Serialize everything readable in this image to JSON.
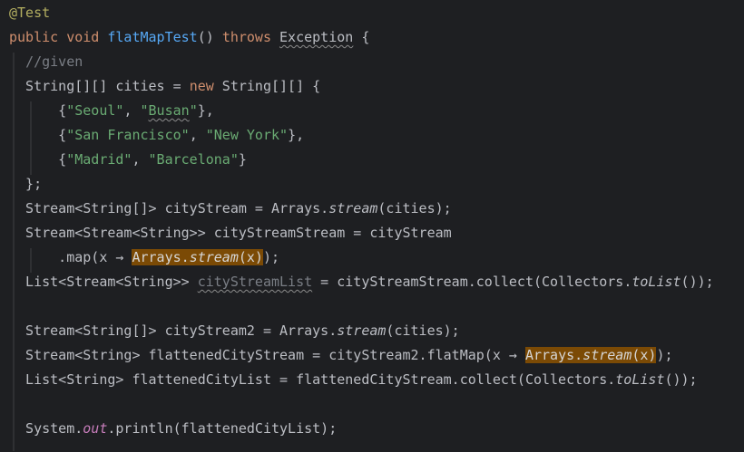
{
  "lines": [
    [
      {
        "t": "@Test",
        "k": "annotation"
      }
    ],
    [
      {
        "t": "public",
        "k": "keyword"
      },
      {
        "t": " "
      },
      {
        "t": "void",
        "k": "keyword"
      },
      {
        "t": " "
      },
      {
        "t": "flatMapTest",
        "k": "method-decl"
      },
      {
        "t": "() "
      },
      {
        "t": "throws",
        "k": "keyword"
      },
      {
        "t": " "
      },
      {
        "t": "Exception",
        "k": "squiggle"
      },
      {
        "t": " {"
      }
    ],
    [
      {
        "t": "  "
      },
      {
        "t": "//given",
        "k": "comment"
      }
    ],
    [
      {
        "t": "  String[][] cities = "
      },
      {
        "t": "new",
        "k": "keyword"
      },
      {
        "t": " String[][] {"
      }
    ],
    [
      {
        "t": "      {"
      },
      {
        "t": "\"Seoul\"",
        "k": "string"
      },
      {
        "t": ", "
      },
      {
        "t": "\"",
        "k": "string"
      },
      {
        "t": "Busan",
        "k": "string squiggle"
      },
      {
        "t": "\"",
        "k": "string"
      },
      {
        "t": "},"
      }
    ],
    [
      {
        "t": "      {"
      },
      {
        "t": "\"San Francisco\"",
        "k": "string"
      },
      {
        "t": ", "
      },
      {
        "t": "\"New York\"",
        "k": "string"
      },
      {
        "t": "},"
      }
    ],
    [
      {
        "t": "      {"
      },
      {
        "t": "\"Madrid\"",
        "k": "string"
      },
      {
        "t": ", "
      },
      {
        "t": "\"Barcelona\"",
        "k": "string"
      },
      {
        "t": "}"
      }
    ],
    [
      {
        "t": "  };"
      }
    ],
    [
      {
        "t": "  Stream<String[]> cityStream = Arrays."
      },
      {
        "t": "stream",
        "k": "static-italic"
      },
      {
        "t": "(cities);"
      }
    ],
    [
      {
        "t": "  Stream<Stream<String>> cityStreamStream = cityStream"
      }
    ],
    [
      {
        "t": "      .map(x → "
      },
      {
        "t": "Arrays.",
        "k": "highlight"
      },
      {
        "t": "stream",
        "k": "highlight static-italic"
      },
      {
        "t": "(x)",
        "k": "highlight"
      },
      {
        "t": ");"
      }
    ],
    [
      {
        "t": "  List<Stream<String>> "
      },
      {
        "t": "cityStreamList",
        "k": "unused squiggle"
      },
      {
        "t": " = cityStreamStream.collect(Collectors."
      },
      {
        "t": "toList",
        "k": "static-italic"
      },
      {
        "t": "());"
      }
    ],
    [],
    [
      {
        "t": "  Stream<String[]> cityStream2 = Arrays."
      },
      {
        "t": "stream",
        "k": "static-italic"
      },
      {
        "t": "(cities);"
      }
    ],
    [
      {
        "t": "  Stream<String> flattenedCityStream = cityStream2.flatMap(x → "
      },
      {
        "t": "Arrays.",
        "k": "highlight"
      },
      {
        "t": "stream",
        "k": "highlight static-italic"
      },
      {
        "t": "(x)",
        "k": "highlight"
      },
      {
        "t": ");"
      }
    ],
    [
      {
        "t": "  List<String> flattenedCityList = flattenedCityStream.collect(Collectors."
      },
      {
        "t": "toList",
        "k": "static-italic"
      },
      {
        "t": "());"
      }
    ],
    [],
    [
      {
        "t": "  System."
      },
      {
        "t": "out",
        "k": "static-field"
      },
      {
        "t": ".println(flattenedCityList);"
      }
    ]
  ]
}
